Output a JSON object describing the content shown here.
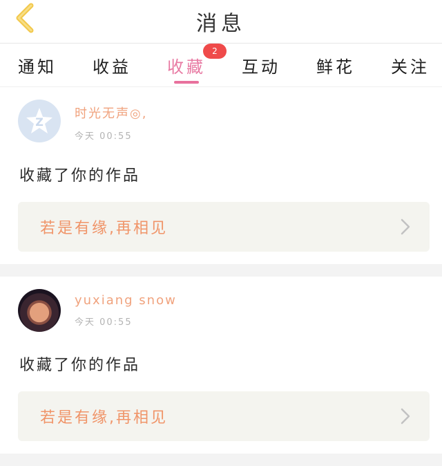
{
  "header": {
    "title": "消息"
  },
  "tabs": [
    {
      "label": "通知"
    },
    {
      "label": "收益"
    },
    {
      "label": "收藏",
      "badge": "2"
    },
    {
      "label": "互动"
    },
    {
      "label": "鲜花"
    },
    {
      "label": "关注"
    }
  ],
  "messages": [
    {
      "username": "时光无声◎,",
      "time": "今天 00:55",
      "action": "收藏了你的作品",
      "quote": "若是有缘,再相见"
    },
    {
      "username": "yuxiang snow",
      "time": "今天 00:55",
      "action": "收藏了你的作品",
      "quote": "若是有缘,再相见"
    }
  ],
  "colors": {
    "accent": "#e8719d",
    "badge": "#ef4a4a",
    "username": "#f0a27d",
    "quote": "#f09468",
    "back_arrow": "#f2c84b"
  },
  "icons": {
    "back": "chevron-left-icon",
    "arrow": "chevron-right-icon",
    "default_avatar": "qzone-star-icon"
  }
}
